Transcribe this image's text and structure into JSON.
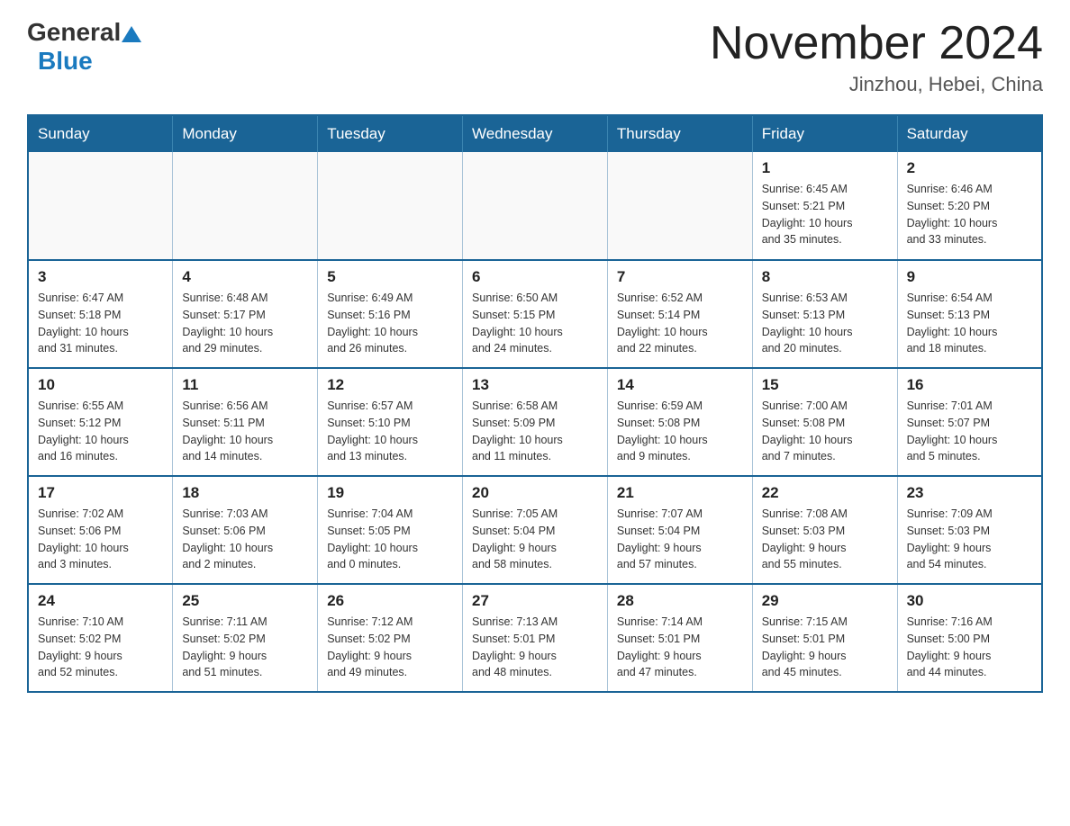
{
  "header": {
    "logo_general": "General",
    "logo_blue": "Blue",
    "month_title": "November 2024",
    "location": "Jinzhou, Hebei, China"
  },
  "weekdays": [
    "Sunday",
    "Monday",
    "Tuesday",
    "Wednesday",
    "Thursday",
    "Friday",
    "Saturday"
  ],
  "weeks": [
    [
      {
        "day": "",
        "info": ""
      },
      {
        "day": "",
        "info": ""
      },
      {
        "day": "",
        "info": ""
      },
      {
        "day": "",
        "info": ""
      },
      {
        "day": "",
        "info": ""
      },
      {
        "day": "1",
        "info": "Sunrise: 6:45 AM\nSunset: 5:21 PM\nDaylight: 10 hours\nand 35 minutes."
      },
      {
        "day": "2",
        "info": "Sunrise: 6:46 AM\nSunset: 5:20 PM\nDaylight: 10 hours\nand 33 minutes."
      }
    ],
    [
      {
        "day": "3",
        "info": "Sunrise: 6:47 AM\nSunset: 5:18 PM\nDaylight: 10 hours\nand 31 minutes."
      },
      {
        "day": "4",
        "info": "Sunrise: 6:48 AM\nSunset: 5:17 PM\nDaylight: 10 hours\nand 29 minutes."
      },
      {
        "day": "5",
        "info": "Sunrise: 6:49 AM\nSunset: 5:16 PM\nDaylight: 10 hours\nand 26 minutes."
      },
      {
        "day": "6",
        "info": "Sunrise: 6:50 AM\nSunset: 5:15 PM\nDaylight: 10 hours\nand 24 minutes."
      },
      {
        "day": "7",
        "info": "Sunrise: 6:52 AM\nSunset: 5:14 PM\nDaylight: 10 hours\nand 22 minutes."
      },
      {
        "day": "8",
        "info": "Sunrise: 6:53 AM\nSunset: 5:13 PM\nDaylight: 10 hours\nand 20 minutes."
      },
      {
        "day": "9",
        "info": "Sunrise: 6:54 AM\nSunset: 5:13 PM\nDaylight: 10 hours\nand 18 minutes."
      }
    ],
    [
      {
        "day": "10",
        "info": "Sunrise: 6:55 AM\nSunset: 5:12 PM\nDaylight: 10 hours\nand 16 minutes."
      },
      {
        "day": "11",
        "info": "Sunrise: 6:56 AM\nSunset: 5:11 PM\nDaylight: 10 hours\nand 14 minutes."
      },
      {
        "day": "12",
        "info": "Sunrise: 6:57 AM\nSunset: 5:10 PM\nDaylight: 10 hours\nand 13 minutes."
      },
      {
        "day": "13",
        "info": "Sunrise: 6:58 AM\nSunset: 5:09 PM\nDaylight: 10 hours\nand 11 minutes."
      },
      {
        "day": "14",
        "info": "Sunrise: 6:59 AM\nSunset: 5:08 PM\nDaylight: 10 hours\nand 9 minutes."
      },
      {
        "day": "15",
        "info": "Sunrise: 7:00 AM\nSunset: 5:08 PM\nDaylight: 10 hours\nand 7 minutes."
      },
      {
        "day": "16",
        "info": "Sunrise: 7:01 AM\nSunset: 5:07 PM\nDaylight: 10 hours\nand 5 minutes."
      }
    ],
    [
      {
        "day": "17",
        "info": "Sunrise: 7:02 AM\nSunset: 5:06 PM\nDaylight: 10 hours\nand 3 minutes."
      },
      {
        "day": "18",
        "info": "Sunrise: 7:03 AM\nSunset: 5:06 PM\nDaylight: 10 hours\nand 2 minutes."
      },
      {
        "day": "19",
        "info": "Sunrise: 7:04 AM\nSunset: 5:05 PM\nDaylight: 10 hours\nand 0 minutes."
      },
      {
        "day": "20",
        "info": "Sunrise: 7:05 AM\nSunset: 5:04 PM\nDaylight: 9 hours\nand 58 minutes."
      },
      {
        "day": "21",
        "info": "Sunrise: 7:07 AM\nSunset: 5:04 PM\nDaylight: 9 hours\nand 57 minutes."
      },
      {
        "day": "22",
        "info": "Sunrise: 7:08 AM\nSunset: 5:03 PM\nDaylight: 9 hours\nand 55 minutes."
      },
      {
        "day": "23",
        "info": "Sunrise: 7:09 AM\nSunset: 5:03 PM\nDaylight: 9 hours\nand 54 minutes."
      }
    ],
    [
      {
        "day": "24",
        "info": "Sunrise: 7:10 AM\nSunset: 5:02 PM\nDaylight: 9 hours\nand 52 minutes."
      },
      {
        "day": "25",
        "info": "Sunrise: 7:11 AM\nSunset: 5:02 PM\nDaylight: 9 hours\nand 51 minutes."
      },
      {
        "day": "26",
        "info": "Sunrise: 7:12 AM\nSunset: 5:02 PM\nDaylight: 9 hours\nand 49 minutes."
      },
      {
        "day": "27",
        "info": "Sunrise: 7:13 AM\nSunset: 5:01 PM\nDaylight: 9 hours\nand 48 minutes."
      },
      {
        "day": "28",
        "info": "Sunrise: 7:14 AM\nSunset: 5:01 PM\nDaylight: 9 hours\nand 47 minutes."
      },
      {
        "day": "29",
        "info": "Sunrise: 7:15 AM\nSunset: 5:01 PM\nDaylight: 9 hours\nand 45 minutes."
      },
      {
        "day": "30",
        "info": "Sunrise: 7:16 AM\nSunset: 5:00 PM\nDaylight: 9 hours\nand 44 minutes."
      }
    ]
  ]
}
